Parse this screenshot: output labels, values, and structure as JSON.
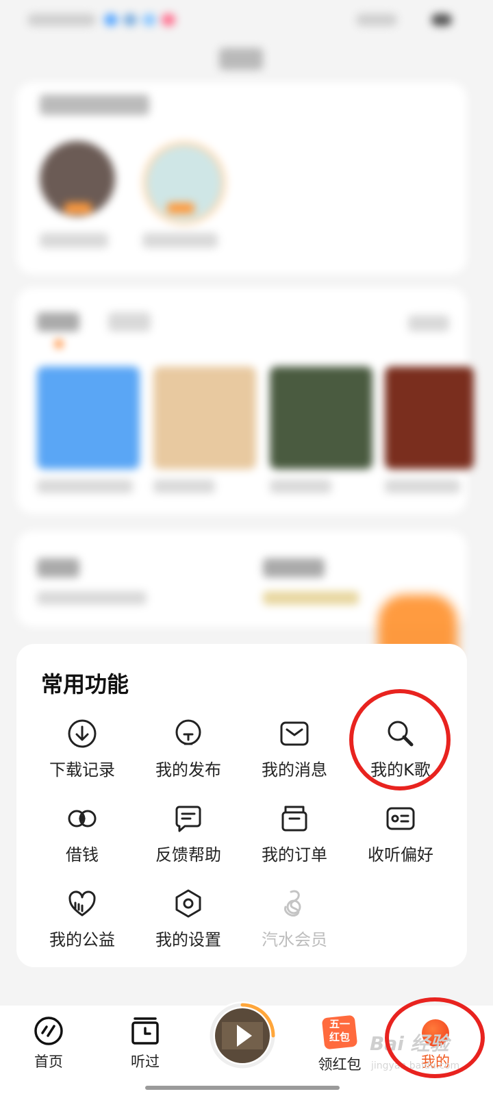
{
  "functions": {
    "title": "常用功能",
    "items": [
      {
        "label": "下载记录",
        "icon": "download-icon"
      },
      {
        "label": "我的发布",
        "icon": "publish-icon"
      },
      {
        "label": "我的消息",
        "icon": "message-icon"
      },
      {
        "label": "我的K歌",
        "icon": "karaoke-icon"
      },
      {
        "label": "借钱",
        "icon": "loan-icon"
      },
      {
        "label": "反馈帮助",
        "icon": "feedback-icon"
      },
      {
        "label": "我的订单",
        "icon": "order-icon"
      },
      {
        "label": "收听偏好",
        "icon": "preference-icon"
      },
      {
        "label": "我的公益",
        "icon": "charity-icon"
      },
      {
        "label": "我的设置",
        "icon": "settings-icon"
      },
      {
        "label": "汽水会员",
        "icon": "soda-member-icon"
      }
    ]
  },
  "tabbar": {
    "home": "首页",
    "history": "听过",
    "redpacket": "领红包",
    "redpacket_badge_top": "五一",
    "redpacket_badge_bottom": "红包",
    "mine": "我的"
  },
  "watermark": {
    "text": "Bai 经验",
    "url": "jingyan.baidu.com"
  },
  "colors": {
    "accent": "#ff6a00",
    "highlight": "#e8231f"
  }
}
